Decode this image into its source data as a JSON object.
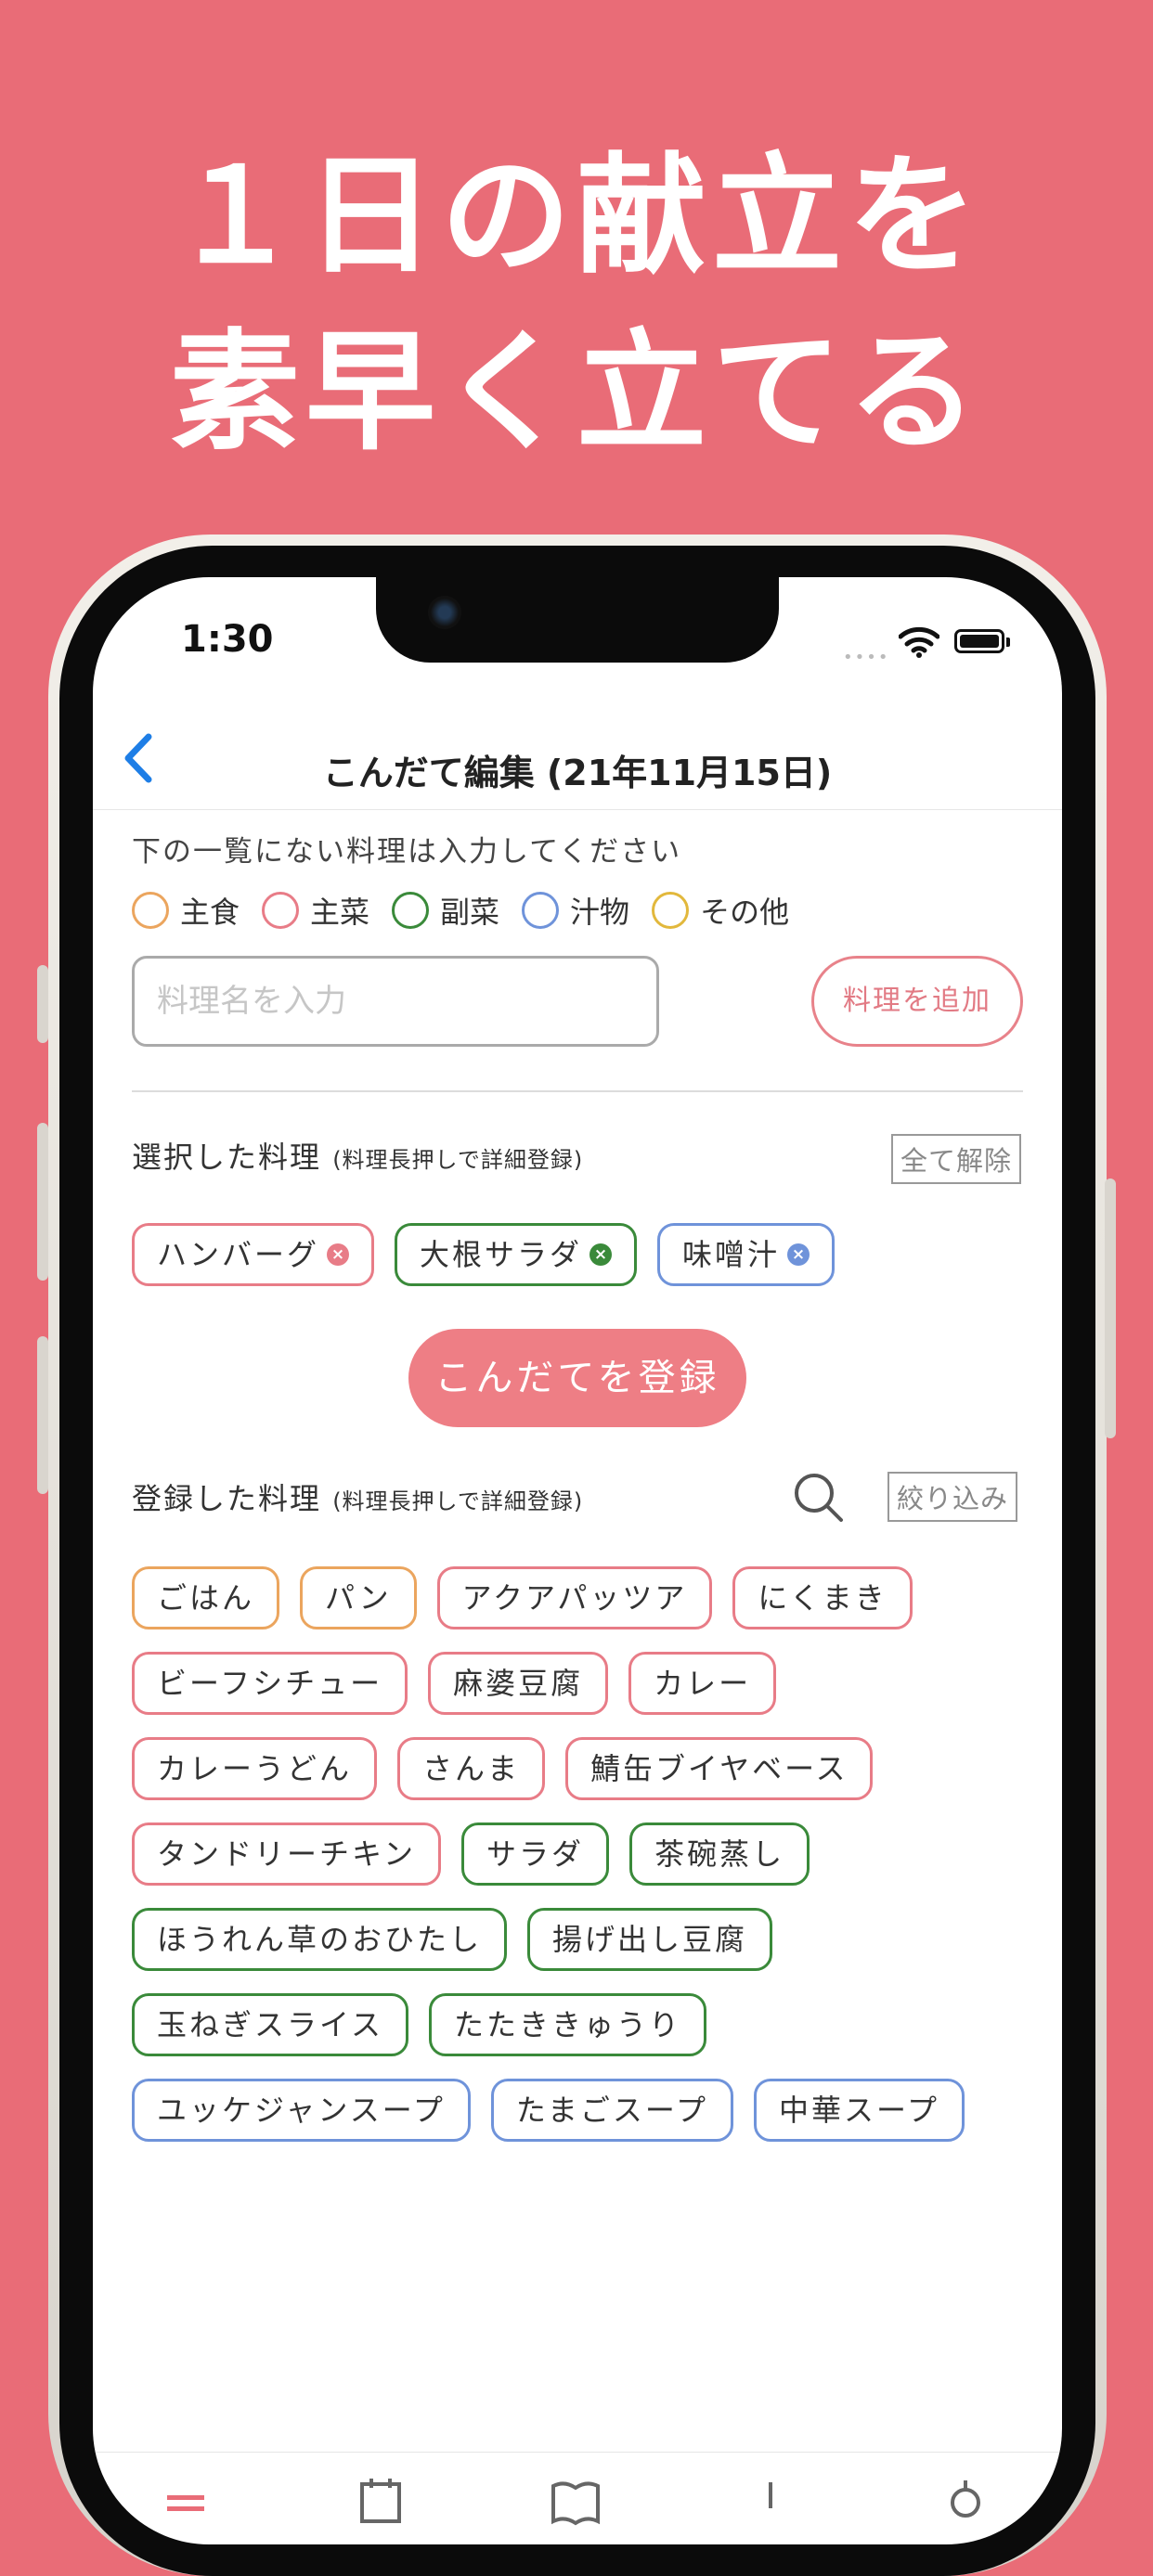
{
  "headline": {
    "line1": "１日の献立を",
    "line2": "素早く立てる"
  },
  "status": {
    "time": "1:30",
    "signal": "••••"
  },
  "nav": {
    "title": "こんだて編集 (21年11月15日)"
  },
  "hint": "下の一覧にない料理は入力してください",
  "categories": [
    {
      "label": "主食",
      "color": "#eba55e"
    },
    {
      "label": "主菜",
      "color": "#e87c87"
    },
    {
      "label": "副菜",
      "color": "#3a8a3a"
    },
    {
      "label": "汁物",
      "color": "#6f93da"
    },
    {
      "label": "その他",
      "color": "#e2b83c"
    }
  ],
  "dish_input": {
    "placeholder": "料理名を入力",
    "value": ""
  },
  "add_button": "料理を追加",
  "selected": {
    "title": "選択した料理",
    "note": "(料理長押しで詳細登録)",
    "clear_button": "全て解除",
    "items": [
      {
        "label": "ハンバーグ",
        "color": "#e87c87"
      },
      {
        "label": "大根サラダ",
        "color": "#3a8a3a"
      },
      {
        "label": "味噌汁",
        "color": "#6f93da"
      }
    ]
  },
  "register_button": "こんだてを登録",
  "registered": {
    "title": "登録した料理",
    "note": "(料理長押しで詳細登録)",
    "filter_button": "絞り込み",
    "items": [
      {
        "label": "ごはん",
        "color": "#eba55e"
      },
      {
        "label": "パン",
        "color": "#eba55e"
      },
      {
        "label": "アクアパッツア",
        "color": "#e87c87"
      },
      {
        "label": "にくまき",
        "color": "#e87c87"
      },
      {
        "label": "ビーフシチュー",
        "color": "#e87c87"
      },
      {
        "label": "麻婆豆腐",
        "color": "#e87c87"
      },
      {
        "label": "カレー",
        "color": "#e87c87"
      },
      {
        "label": "カレーうどん",
        "color": "#e87c87"
      },
      {
        "label": "さんま",
        "color": "#e87c87"
      },
      {
        "label": "鯖缶ブイヤベース",
        "color": "#e87c87"
      },
      {
        "label": "タンドリーチキン",
        "color": "#e87c87"
      },
      {
        "label": "サラダ",
        "color": "#3a8a3a"
      },
      {
        "label": "茶碗蒸し",
        "color": "#3a8a3a"
      },
      {
        "label": "ほうれん草のおひたし",
        "color": "#3a8a3a"
      },
      {
        "label": "揚げ出し豆腐",
        "color": "#3a8a3a"
      },
      {
        "label": "玉ねぎスライス",
        "color": "#3a8a3a"
      },
      {
        "label": "たたききゅうり",
        "color": "#3a8a3a"
      },
      {
        "label": "ユッケジャンスープ",
        "color": "#6f93da"
      },
      {
        "label": "たまごスープ",
        "color": "#6f93da"
      },
      {
        "label": "中華スープ",
        "color": "#6f93da"
      }
    ]
  },
  "tabbar": {
    "icons": [
      "menu-icon",
      "calendar-icon",
      "book-icon",
      "list-icon",
      "gear-icon"
    ],
    "active_color": "#e96c77"
  }
}
